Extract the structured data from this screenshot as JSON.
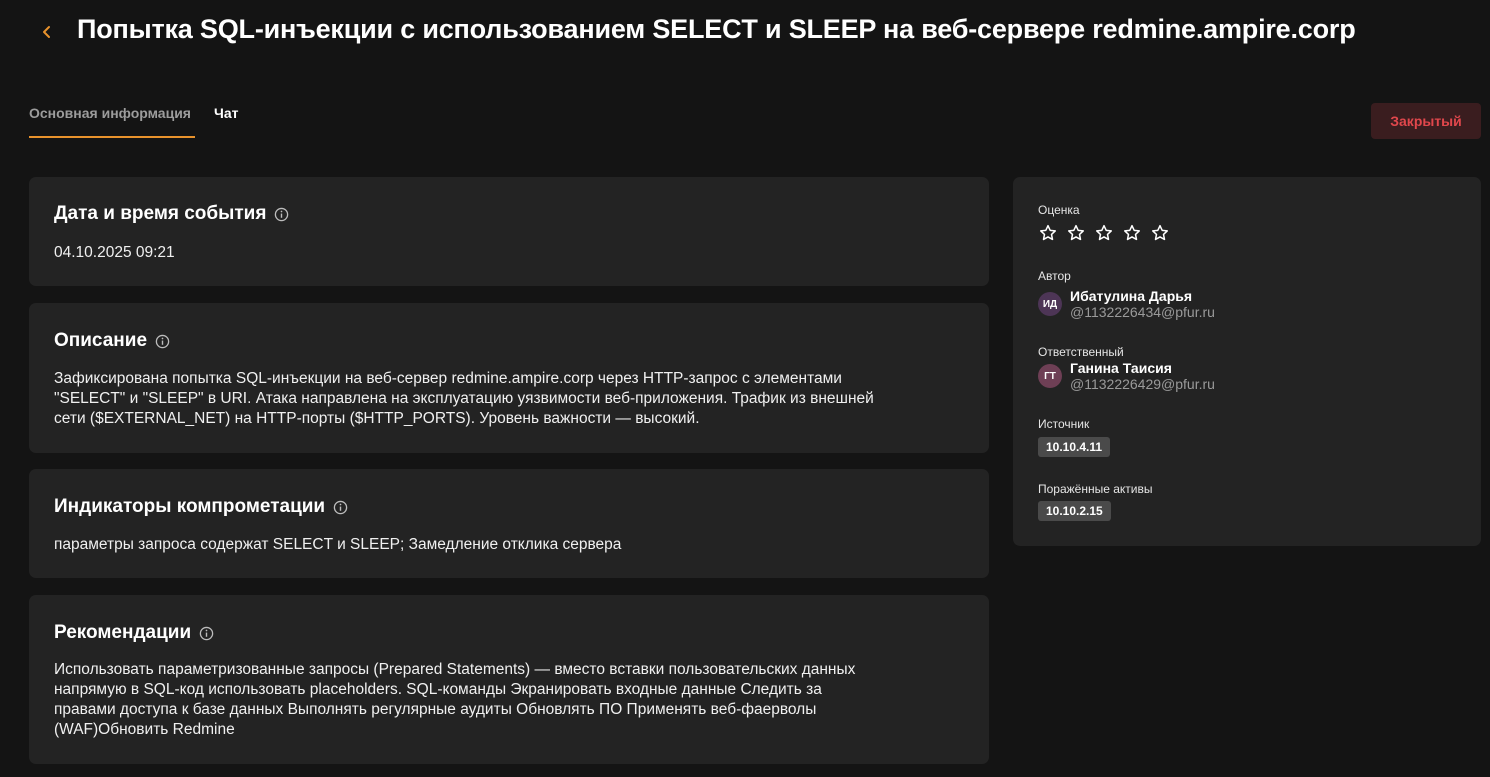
{
  "header": {
    "title": "Попытка SQL-инъекции с использованием SELECT и SLEEP на веб-сервере redmine.ampire.corp"
  },
  "tabs": [
    {
      "label": "Основная информация",
      "active": true
    },
    {
      "label": "Чат",
      "active": false
    }
  ],
  "status": {
    "label": "Закрытый",
    "color": "#e0474c"
  },
  "sections": {
    "datetime": {
      "title": "Дата и время события",
      "text": "04.10.2025 09:21"
    },
    "description": {
      "title": "Описание",
      "lines": [
        "Зафиксирована попытка SQL-инъекции на веб-сервер redmine.ampire.corp через HTTP-запрос с элементами",
        "\"SELECT\" и \"SLEEP\" в URI. Атака направлена на эксплуатацию уязвимости веб-приложения. Трафик из внешней",
        "сети ($EXTERNAL_NET) на HTTP-порты ($HTTP_PORTS). Уровень важности — высокий."
      ]
    },
    "indicators": {
      "title": "Индикаторы компрометации",
      "text": "параметры запроса содержат SELECT и SLEEP; Замедление отклика сервера"
    },
    "recommendations": {
      "title": "Рекомендации",
      "lines": [
        "Использовать параметризованные запросы (Prepared Statements) — вместо вставки пользовательских данных",
        "напрямую в SQL-код использовать placeholders. SQL-команды Экранировать входные данные Следить за",
        "правами доступа к базе данных Выполнять регулярные аудиты Обновлять ПО Применять веб-фаерволы",
        "(WAF)Обновить Redmine"
      ]
    }
  },
  "sidebar": {
    "rating": {
      "label": "Оценка",
      "value": 0,
      "max": 5
    },
    "author": {
      "label": "Автор",
      "initials": "ИД",
      "name": "Ибатулина Дарья",
      "email": "@1132226434@pfur.ru"
    },
    "assignee": {
      "label": "Ответственный",
      "initials": "ГТ",
      "name": "Ганина Таисия",
      "email": "@1132226429@pfur.ru"
    },
    "source": {
      "label": "Источник",
      "value": "10.10.4.11"
    },
    "assets": {
      "label": "Поражённые активы",
      "value": "10.10.2.15"
    }
  },
  "colors": {
    "accent": "#e8922c",
    "background": "#141414",
    "card": "#232323"
  }
}
